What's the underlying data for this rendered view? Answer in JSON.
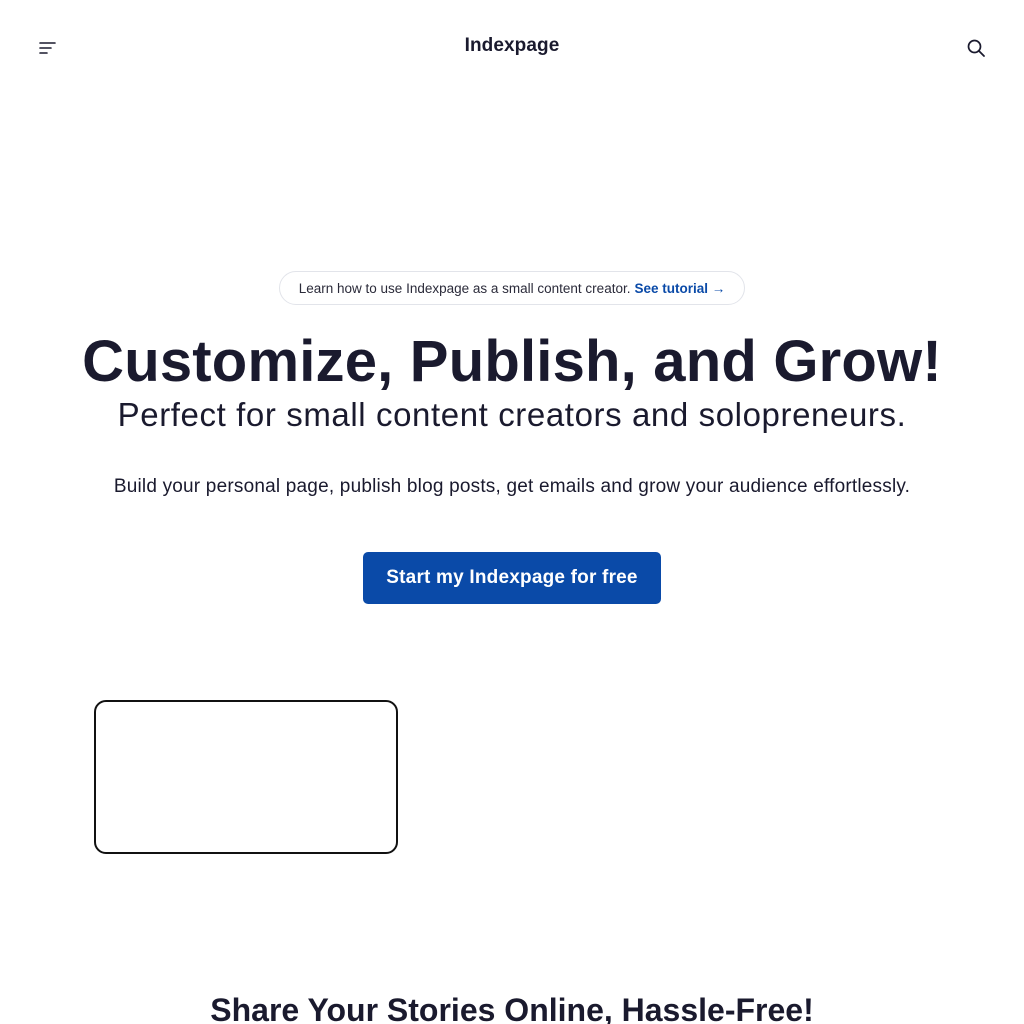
{
  "header": {
    "brand": "Indexpage",
    "menu_icon": "menu-icon",
    "search_icon": "search-icon"
  },
  "announcement": {
    "text": "Learn how to use Indexpage as a small content creator.",
    "link_label": "See tutorial →"
  },
  "hero": {
    "title": "Customize, Publish, and Grow!",
    "subtitle": "Perfect for small content creators and solopreneurs.",
    "description": "Build your personal page, publish blog posts, get emails and grow your audience effortlessly.",
    "cta_label": "Start my Indexpage for free"
  },
  "section": {
    "title": "Share Your Stories Online, Hassle-Free!"
  },
  "colors": {
    "accent": "#0a4aa8",
    "text": "#1a1a2e",
    "background": "#ffffff"
  }
}
